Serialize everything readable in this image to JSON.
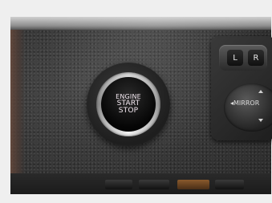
{
  "photo": {
    "start_button": {
      "lines": [
        "ENGINE",
        "START",
        "STOP"
      ]
    },
    "mirror_controls": {
      "left_label": "L",
      "right_label": "R",
      "mirror_label": "◂MIRROR"
    }
  }
}
